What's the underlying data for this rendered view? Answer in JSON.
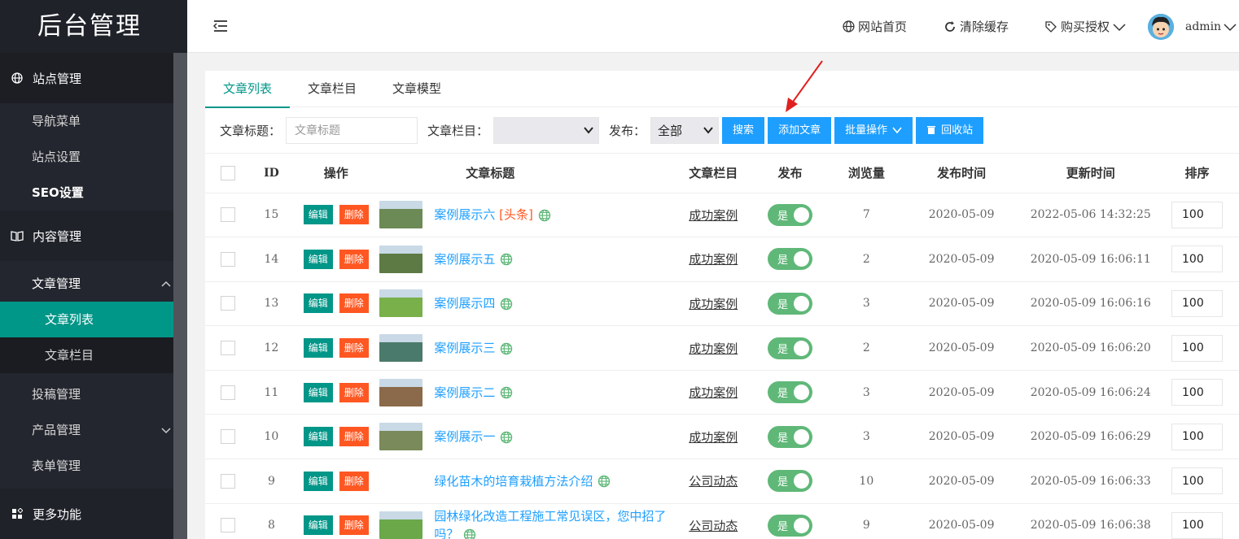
{
  "sidebar": {
    "logo": "后台管理",
    "groups": [
      {
        "label": "站点管理",
        "items": [
          "导航菜单",
          "站点设置",
          "SEO设置"
        ]
      },
      {
        "label": "内容管理"
      },
      {
        "label": "更多功能"
      }
    ],
    "content_items": {
      "article": "文章管理",
      "article_sub": [
        "文章列表",
        "文章栏目"
      ],
      "submission": "投稿管理",
      "product": "产品管理",
      "form": "表单管理"
    }
  },
  "header": {
    "site_home": "网站首页",
    "clear_cache": "清除缓存",
    "buy_license": "购买授权",
    "username": "admin"
  },
  "tabs": [
    "文章列表",
    "文章栏目",
    "文章模型"
  ],
  "filters": {
    "title_label": "文章标题：",
    "title_placeholder": "文章标题",
    "category_label": "文章栏目：",
    "category_value": "",
    "publish_label": "发布：",
    "publish_value": "全部",
    "search_btn": "搜索",
    "add_btn": "添加文章",
    "batch_btn": "批量操作",
    "recycle_btn": "回收站"
  },
  "table": {
    "columns": [
      "ID",
      "操作",
      "文章标题",
      "文章栏目",
      "发布",
      "浏览量",
      "发布时间",
      "更新时间",
      "排序"
    ],
    "edit_label": "编辑",
    "delete_label": "删除",
    "switch_label": "是",
    "rows": [
      {
        "id": "15",
        "title": "案例展示六",
        "tag": "[头条]",
        "category": "成功案例",
        "views": "7",
        "published": "2020-05-09",
        "updated": "2022-05-06 14:32:25",
        "sort": "100",
        "thumb": "#6c8a55"
      },
      {
        "id": "14",
        "title": "案例展示五",
        "tag": "",
        "category": "成功案例",
        "views": "2",
        "published": "2020-05-09",
        "updated": "2020-05-09 16:06:11",
        "sort": "100",
        "thumb": "#5d7a44"
      },
      {
        "id": "13",
        "title": "案例展示四",
        "tag": "",
        "category": "成功案例",
        "views": "3",
        "published": "2020-05-09",
        "updated": "2020-05-09 16:06:16",
        "sort": "100",
        "thumb": "#79b04a"
      },
      {
        "id": "12",
        "title": "案例展示三",
        "tag": "",
        "category": "成功案例",
        "views": "2",
        "published": "2020-05-09",
        "updated": "2020-05-09 16:06:20",
        "sort": "100",
        "thumb": "#4a7a6b"
      },
      {
        "id": "11",
        "title": "案例展示二",
        "tag": "",
        "category": "成功案例",
        "views": "3",
        "published": "2020-05-09",
        "updated": "2020-05-09 16:06:24",
        "sort": "100",
        "thumb": "#8a6a4a"
      },
      {
        "id": "10",
        "title": "案例展示一",
        "tag": "",
        "category": "成功案例",
        "views": "3",
        "published": "2020-05-09",
        "updated": "2020-05-09 16:06:29",
        "sort": "100",
        "thumb": "#7a8a5a"
      },
      {
        "id": "9",
        "title": "绿化苗木的培育栽植方法介绍",
        "tag": "",
        "category": "公司动态",
        "views": "10",
        "published": "2020-05-09",
        "updated": "2020-05-09 16:06:33",
        "sort": "100",
        "thumb": ""
      },
      {
        "id": "8",
        "title": "园林绿化改造工程施工常见误区，您中招了吗？",
        "tag": "",
        "category": "公司动态",
        "views": "9",
        "published": "2020-05-09",
        "updated": "2020-05-09 16:06:38",
        "sort": "100",
        "thumb": "#6aa84a"
      }
    ]
  },
  "colors": {
    "accent": "#009688",
    "primary": "#1e9fff",
    "danger": "#ff5722",
    "switch_on": "#5fb878"
  }
}
